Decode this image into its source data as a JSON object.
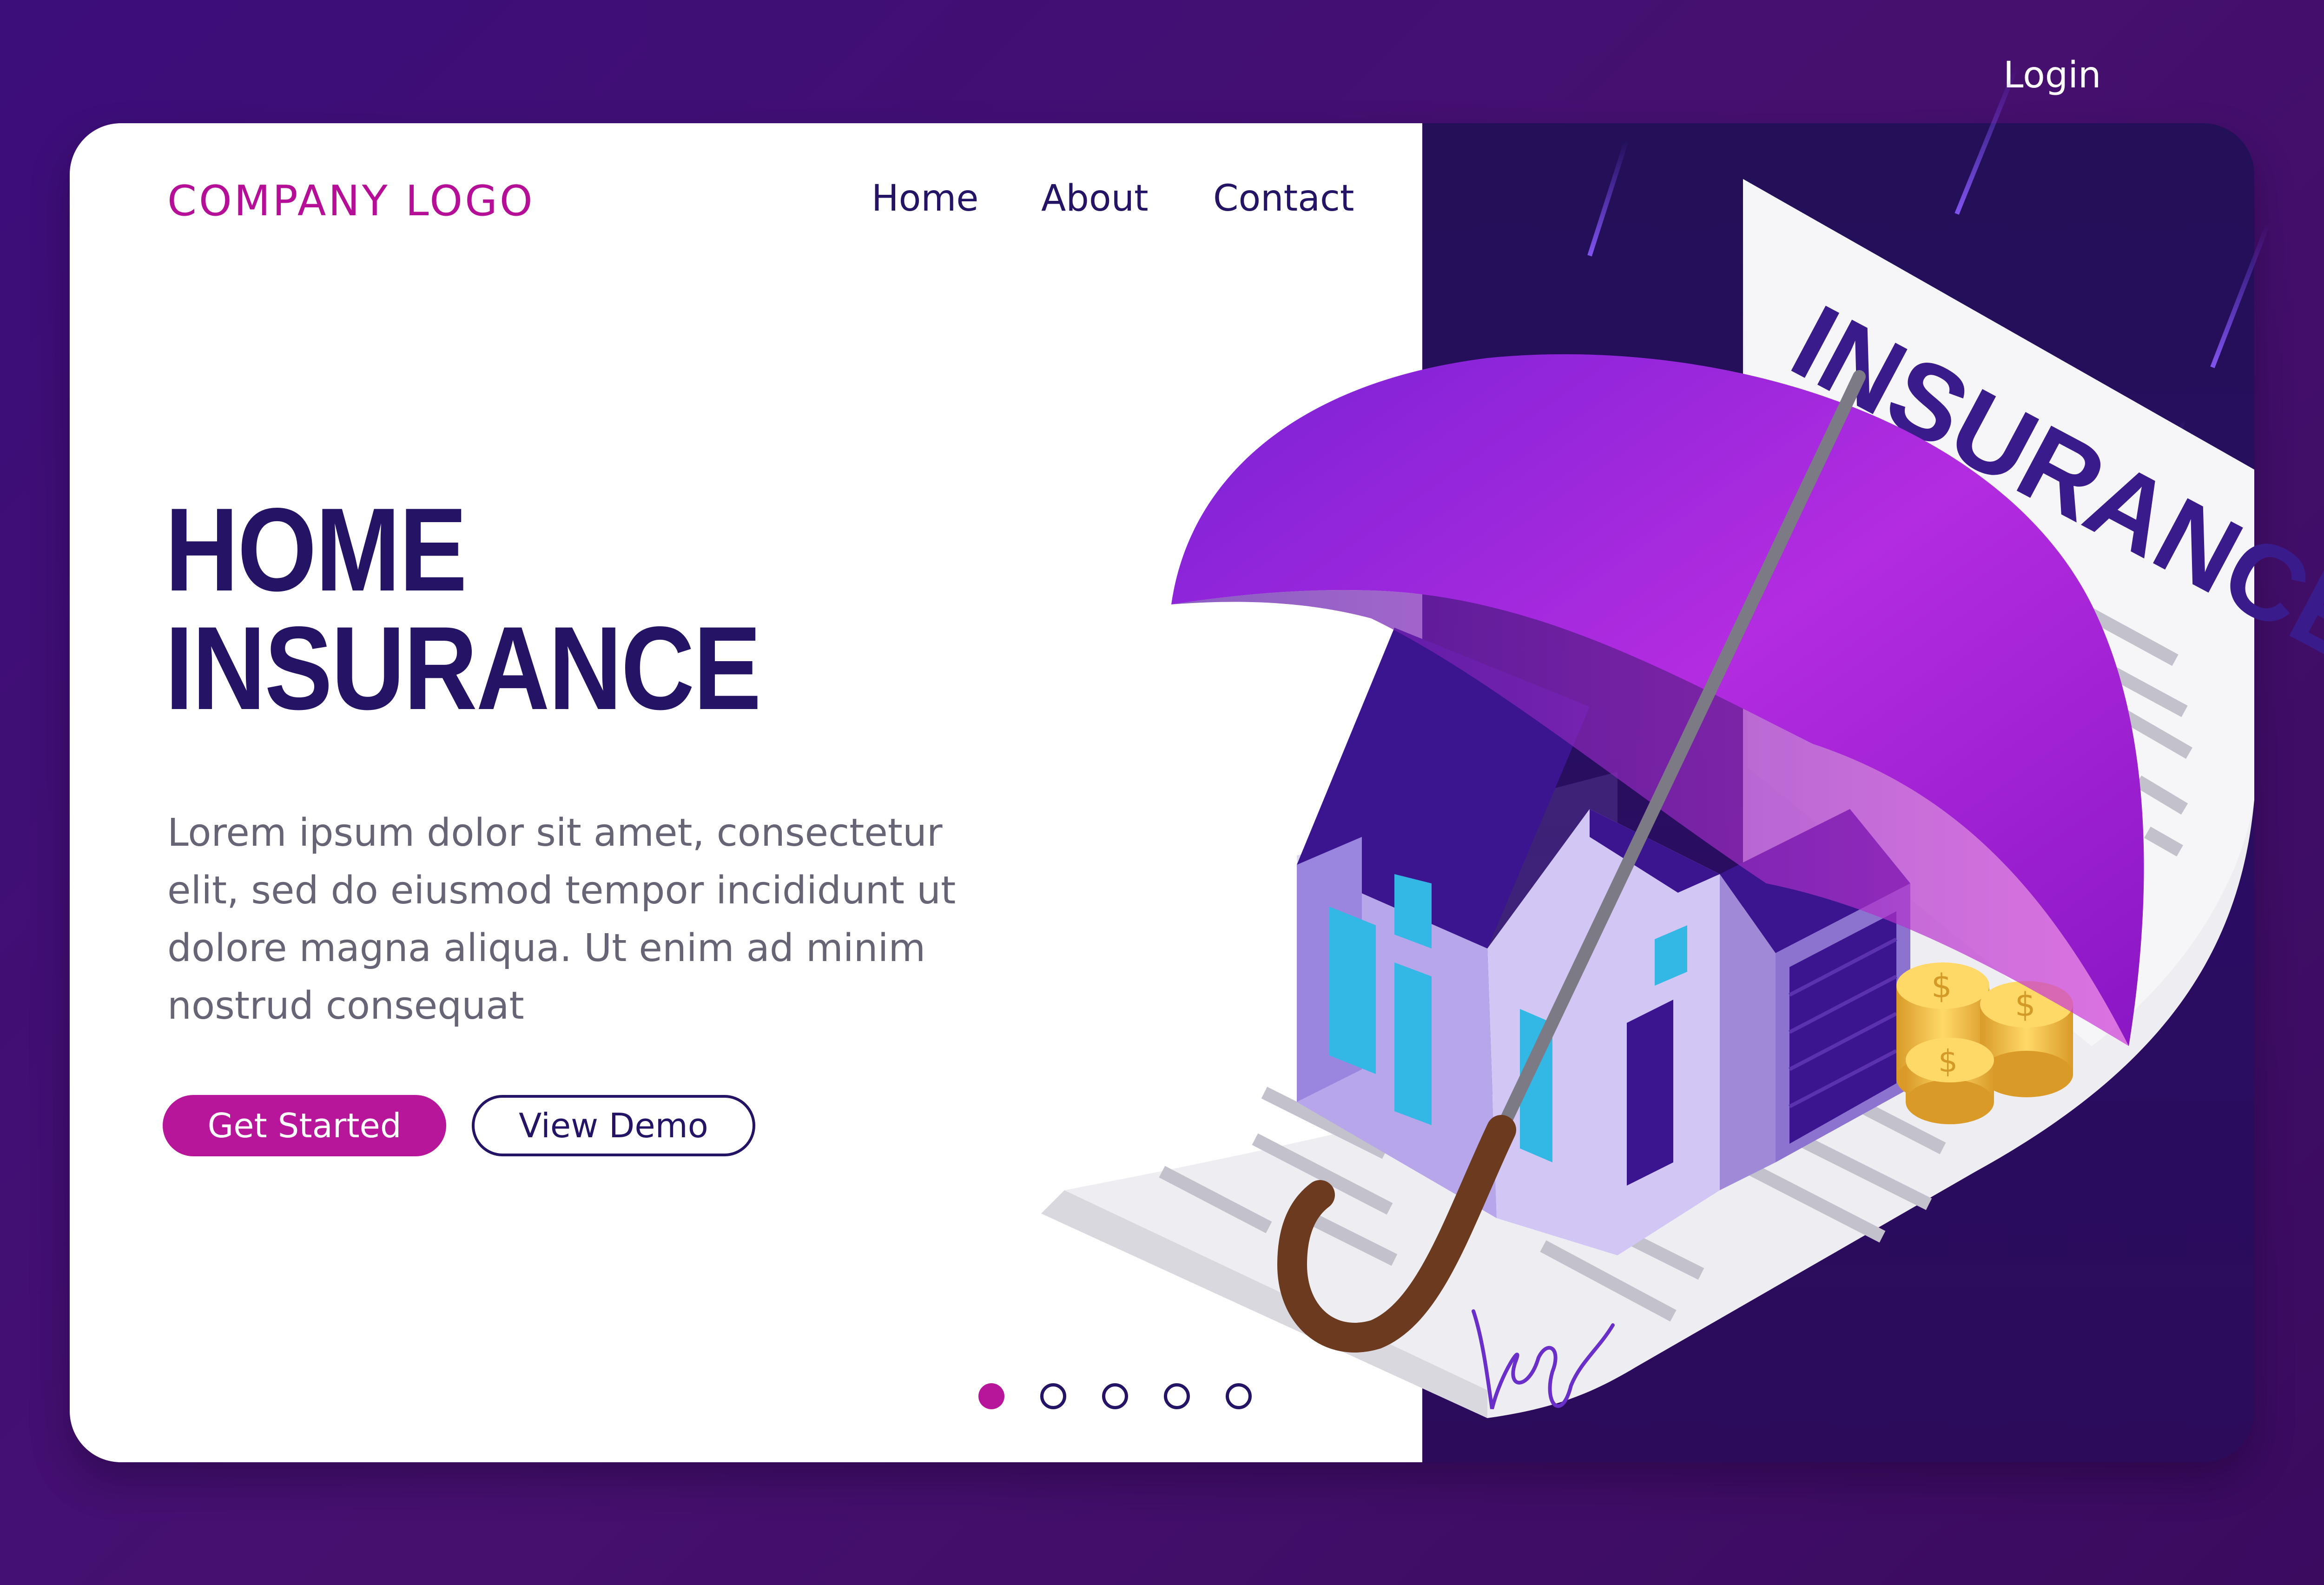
{
  "brand": {
    "logo": "COMPANY LOGO"
  },
  "nav": {
    "home": "Home",
    "about": "About",
    "contact": "Contact",
    "login": "Login"
  },
  "hero": {
    "title_line1": "HOME",
    "title_line2": "INSURANCE",
    "body": "Lorem ipsum dolor sit amet, consectetur elit, sed do eiusmod tempor incididunt ut dolore magna aliqua. Ut enim ad minim nostrud consequat",
    "primary_button": "Get Started",
    "secondary_button": "View Demo"
  },
  "illustration": {
    "document_title": "INSURANCE",
    "icons": [
      "umbrella-icon",
      "house-icon",
      "coins-icon",
      "document-icon",
      "signature-icon"
    ]
  },
  "pagination": {
    "total": 5,
    "active_index": 0
  },
  "colors": {
    "accent": "#b8169a",
    "primary_text": "#251465",
    "background": "#3c0e7a"
  }
}
